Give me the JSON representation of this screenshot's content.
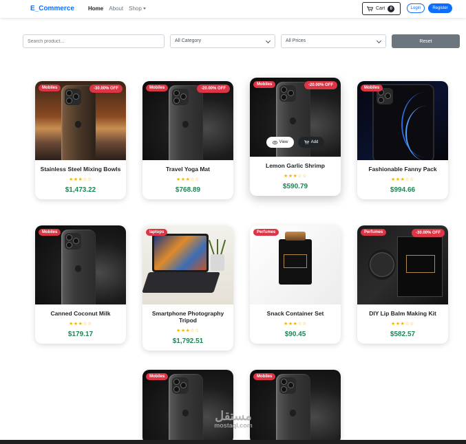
{
  "nav": {
    "brand": "E_Commerce",
    "links": [
      "Home",
      "About",
      "Shop"
    ],
    "cart_label": "Cart",
    "cart_count": "0",
    "login": "Login",
    "register": "Register"
  },
  "filters": {
    "search_placeholder": "Search product...",
    "category": "All Category",
    "price": "All Prices",
    "reset": "Reset"
  },
  "hover_actions": {
    "view": "View",
    "add": "Add"
  },
  "products": [
    {
      "name": "Stainless Steel Mixing Bowls",
      "category": "Mobiles",
      "discount": "-30.00% OFF",
      "price": "$1,473.22",
      "rating": "★★★☆☆"
    },
    {
      "name": "Travel Yoga Mat",
      "category": "Mobiles",
      "discount": "-20.00% OFF",
      "price": "$768.89",
      "rating": "★★★☆☆"
    },
    {
      "name": "Lemon Garlic Shrimp",
      "category": "Mobiles",
      "discount": "-20.00% OFF",
      "price": "$590.79",
      "rating": "★★★☆☆"
    },
    {
      "name": "Fashionable Fanny Pack",
      "category": "Mobiles",
      "discount": "",
      "price": "$994.66",
      "rating": "★★★☆☆"
    },
    {
      "name": "Canned Coconut Milk",
      "category": "Mobiles",
      "discount": "",
      "price": "$179.17",
      "rating": "★★★☆☆"
    },
    {
      "name": "Smartphone Photography Tripod",
      "category": "laptops",
      "discount": "",
      "price": "$1,792.51",
      "rating": "★★★☆☆"
    },
    {
      "name": "Snack Container Set",
      "category": "Perfumes",
      "discount": "",
      "price": "$90.45",
      "rating": "★★★☆☆"
    },
    {
      "name": "DIY Lip Balm Making Kit",
      "category": "Perfumes",
      "discount": "-30.00% OFF",
      "price": "$582.57",
      "rating": "★★★☆☆"
    },
    {
      "name": "",
      "category": "Mobiles",
      "discount": "",
      "price": "",
      "rating": ""
    },
    {
      "name": "",
      "category": "Mobiles",
      "discount": "",
      "price": "",
      "rating": ""
    }
  ],
  "watermark": {
    "arabic": "مستقل",
    "latin": "mostaql.com"
  },
  "colors": {
    "primary": "#0d6efd",
    "danger": "#dc3545",
    "success": "#198754",
    "star": "#f5b301"
  }
}
